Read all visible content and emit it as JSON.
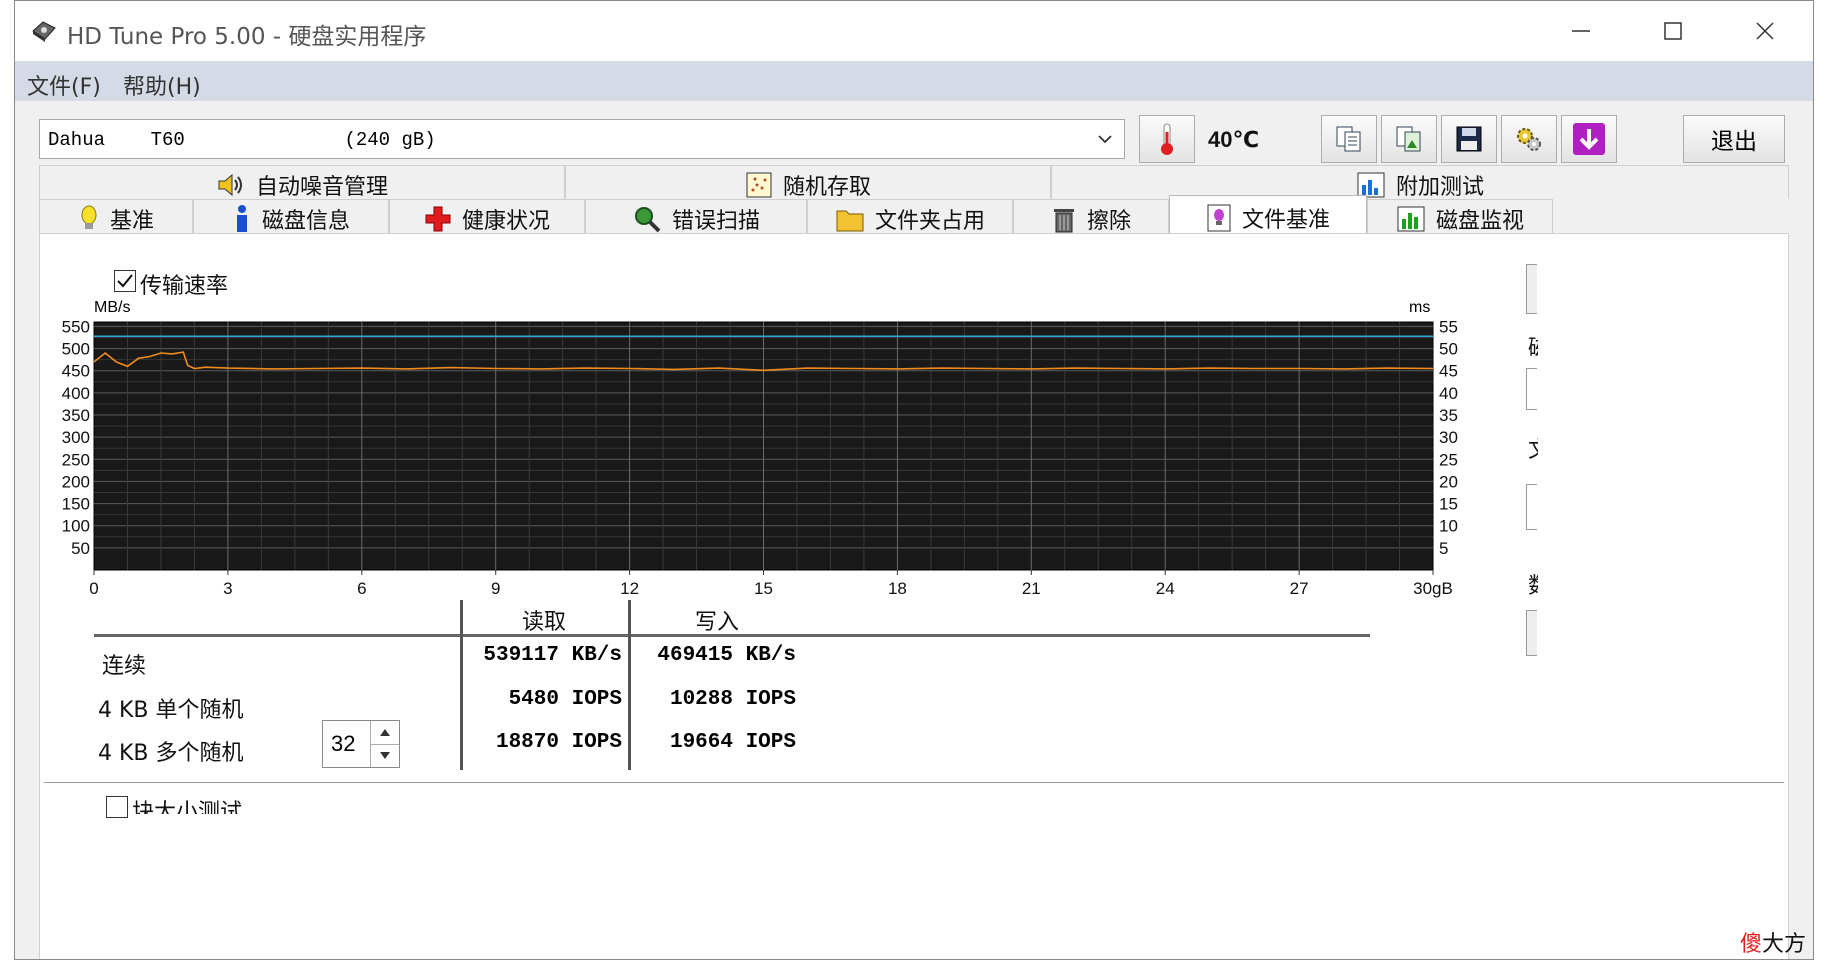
{
  "window": {
    "title": "HD Tune Pro 5.00 - 硬盘实用程序"
  },
  "menu": {
    "file": "文件(F)",
    "help": "帮助(H)"
  },
  "toolbar": {
    "drive": "Dahua    T60              (240 gB)",
    "temperature": "40℃",
    "exit": "退出"
  },
  "tabs_top": [
    {
      "label": "自动噪音管理",
      "icon": "speaker-icon"
    },
    {
      "label": "随机存取",
      "icon": "scatter-chart-icon"
    },
    {
      "label": "附加测试",
      "icon": "bar-chart-icon"
    }
  ],
  "tabs_bottom": [
    {
      "label": "基准",
      "icon": "lightbulb-icon"
    },
    {
      "label": "磁盘信息",
      "icon": "info-icon"
    },
    {
      "label": "健康状况",
      "icon": "red-cross-icon"
    },
    {
      "label": "错误扫描",
      "icon": "magnifier-icon"
    },
    {
      "label": "文件夹占用",
      "icon": "folder-icon"
    },
    {
      "label": "擦除",
      "icon": "trash-icon"
    },
    {
      "label": "文件基准",
      "icon": "file-bulb-icon"
    },
    {
      "label": "磁盘监视",
      "icon": "monitor-chart-icon"
    }
  ],
  "active_tab": "文件基准",
  "transfer_rate": {
    "label": "传输速率",
    "checked": true
  },
  "chart_data": {
    "type": "line",
    "ylabel_left": "MB/s",
    "ylabel_right": "ms",
    "ylim_left": [
      0,
      550
    ],
    "ylim_right": [
      0,
      55
    ],
    "yticks_left": [
      "550",
      "500",
      "450",
      "400",
      "350",
      "300",
      "250",
      "200",
      "150",
      "100",
      "50"
    ],
    "yticks_right": [
      "55",
      "50",
      "45",
      "40",
      "35",
      "30",
      "25",
      "20",
      "15",
      "10",
      "5"
    ],
    "xlim": [
      0,
      30
    ],
    "xticks": [
      "0",
      "3",
      "6",
      "9",
      "12",
      "15",
      "18",
      "21",
      "24",
      "27",
      "30gB"
    ],
    "grid": true,
    "series": [
      {
        "color": "#f08c1e",
        "x": [
          0,
          0.25,
          0.5,
          0.75,
          1,
          1.25,
          1.5,
          1.75,
          2,
          2.1,
          2.25,
          2.5,
          3,
          4,
          5,
          6,
          7,
          8,
          9,
          10,
          11,
          12,
          13,
          14,
          15,
          16,
          17,
          18,
          19,
          20,
          21,
          22,
          23,
          24,
          25,
          26,
          27,
          28,
          29,
          30
        ],
        "values": [
          470,
          490,
          470,
          460,
          478,
          482,
          490,
          488,
          492,
          462,
          455,
          458,
          456,
          454,
          455,
          456,
          454,
          457,
          455,
          454,
          456,
          455,
          453,
          456,
          451,
          456,
          455,
          454,
          456,
          455,
          454,
          456,
          455,
          454,
          456,
          455,
          455,
          454,
          456,
          455
        ]
      },
      {
        "color": "#2aa9d4",
        "x": [
          0,
          30
        ],
        "values": [
          528,
          528
        ]
      }
    ]
  },
  "results": {
    "header_read": "读取",
    "header_write": "写入",
    "rows": [
      {
        "label": "连续",
        "read": "539117 KB/s",
        "write": "469415 KB/s"
      },
      {
        "label": "4 KB 单个随机",
        "read": "5480 IOPS",
        "write": "10288 IOPS"
      },
      {
        "label": "4 KB 多个随机",
        "read": "18870 IOPS",
        "write": "19664 IOPS"
      }
    ],
    "queue_depth": "32"
  },
  "block_size": {
    "label": "块大小测试",
    "checked": false
  },
  "side": {
    "c1": "磁",
    "c2": "文",
    "c3": "数"
  },
  "watermark": {
    "red": "傻",
    "black": "大方"
  }
}
